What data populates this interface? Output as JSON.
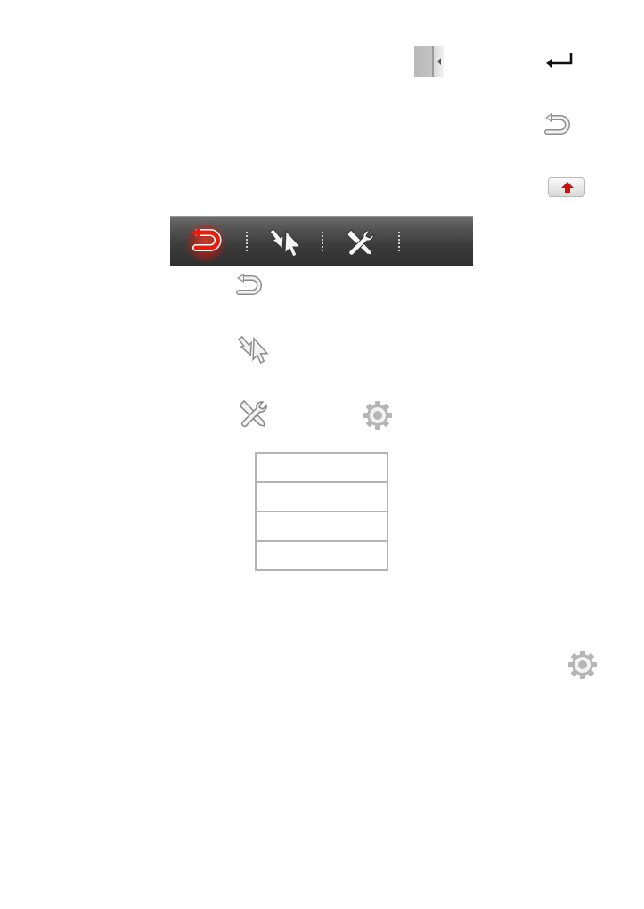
{
  "icons": {
    "panel_tab": "panel-collapse-tab-icon",
    "enter": "enter-return-icon",
    "back_top": "back-arrow-icon",
    "up_button": "red-up-arrow-button",
    "toolbar_back": "back-arrow-icon-highlighted",
    "toolbar_cursor": "cursor-arrows-icon",
    "toolbar_tools": "wrench-screwdriver-icon",
    "list_back": "back-arrow-icon",
    "list_cursor": "cursor-arrows-icon",
    "list_tools": "wrench-screwdriver-icon",
    "list_gear": "gear-icon",
    "bottom_gear": "gear-icon"
  },
  "table": {
    "rows": [
      "",
      "",
      "",
      ""
    ]
  },
  "colors": {
    "toolbar_bg": "#3d3d3d",
    "highlight_red": "#e81c0c",
    "icon_gray": "#a9a9a9"
  }
}
